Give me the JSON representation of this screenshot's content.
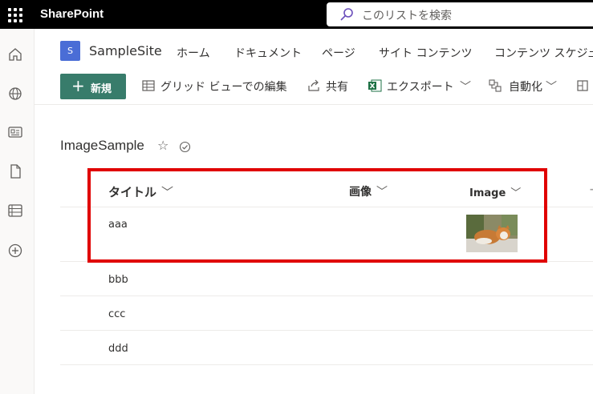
{
  "topbar": {
    "app_name": "SharePoint",
    "search_placeholder": "このリストを検索"
  },
  "site": {
    "logo_letter": "S",
    "name": "SampleSite",
    "nav": [
      "ホーム",
      "ドキュメント",
      "ページ",
      "サイト コンテンツ",
      "コンテンツ スケジューラ"
    ]
  },
  "commands": {
    "new_label": "新規",
    "grid_edit": "グリッド ビューでの編集",
    "share": "共有",
    "export": "エクスポート",
    "automate": "自動化"
  },
  "list": {
    "title": "ImageSample",
    "columns": {
      "title": "タイトル",
      "image_jp": "画像",
      "image_en": "Image"
    },
    "rows": [
      {
        "title": "aaa",
        "has_image": true
      },
      {
        "title": "bbb"
      },
      {
        "title": "ccc"
      },
      {
        "title": "ddd"
      }
    ]
  },
  "colors": {
    "topbar_bg": "#000000",
    "accent": "#387c6b",
    "site_logo": "#4a6dd6",
    "highlight_box": "#e00000",
    "excel_green": "#1e7145"
  }
}
